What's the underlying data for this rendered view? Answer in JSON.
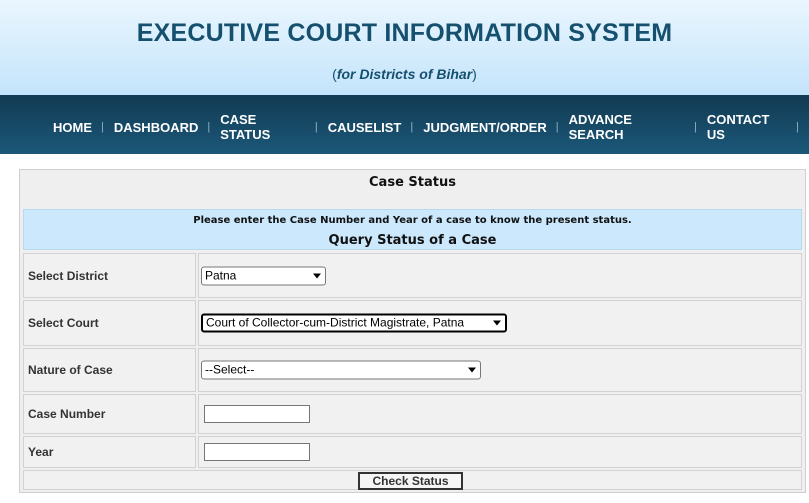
{
  "header": {
    "title": "EXECUTIVE COURT INFORMATION SYSTEM",
    "subtitle": "for Districts of Bihar"
  },
  "nav": {
    "items": [
      {
        "label": "HOME"
      },
      {
        "label": "DASHBOARD"
      },
      {
        "label": "CASE STATUS"
      },
      {
        "label": "CAUSELIST"
      },
      {
        "label": "JUDGMENT/ORDER"
      },
      {
        "label": "ADVANCE SEARCH"
      },
      {
        "label": "CONTACT US"
      }
    ]
  },
  "form": {
    "title": "Case Status",
    "info_message": "Please enter the Case Number and Year of a case to know the present status.",
    "query_heading": "Query Status of a Case",
    "district": {
      "label": "Select District",
      "selected": "Patna"
    },
    "court": {
      "label": "Select Court",
      "selected": "Court of Collector-cum-District Magistrate, Patna"
    },
    "nature": {
      "label": "Nature of Case",
      "selected": "--Select--"
    },
    "case_number": {
      "label": "Case Number",
      "value": ""
    },
    "year": {
      "label": "Year",
      "value": ""
    },
    "submit_label": "Check Status"
  }
}
